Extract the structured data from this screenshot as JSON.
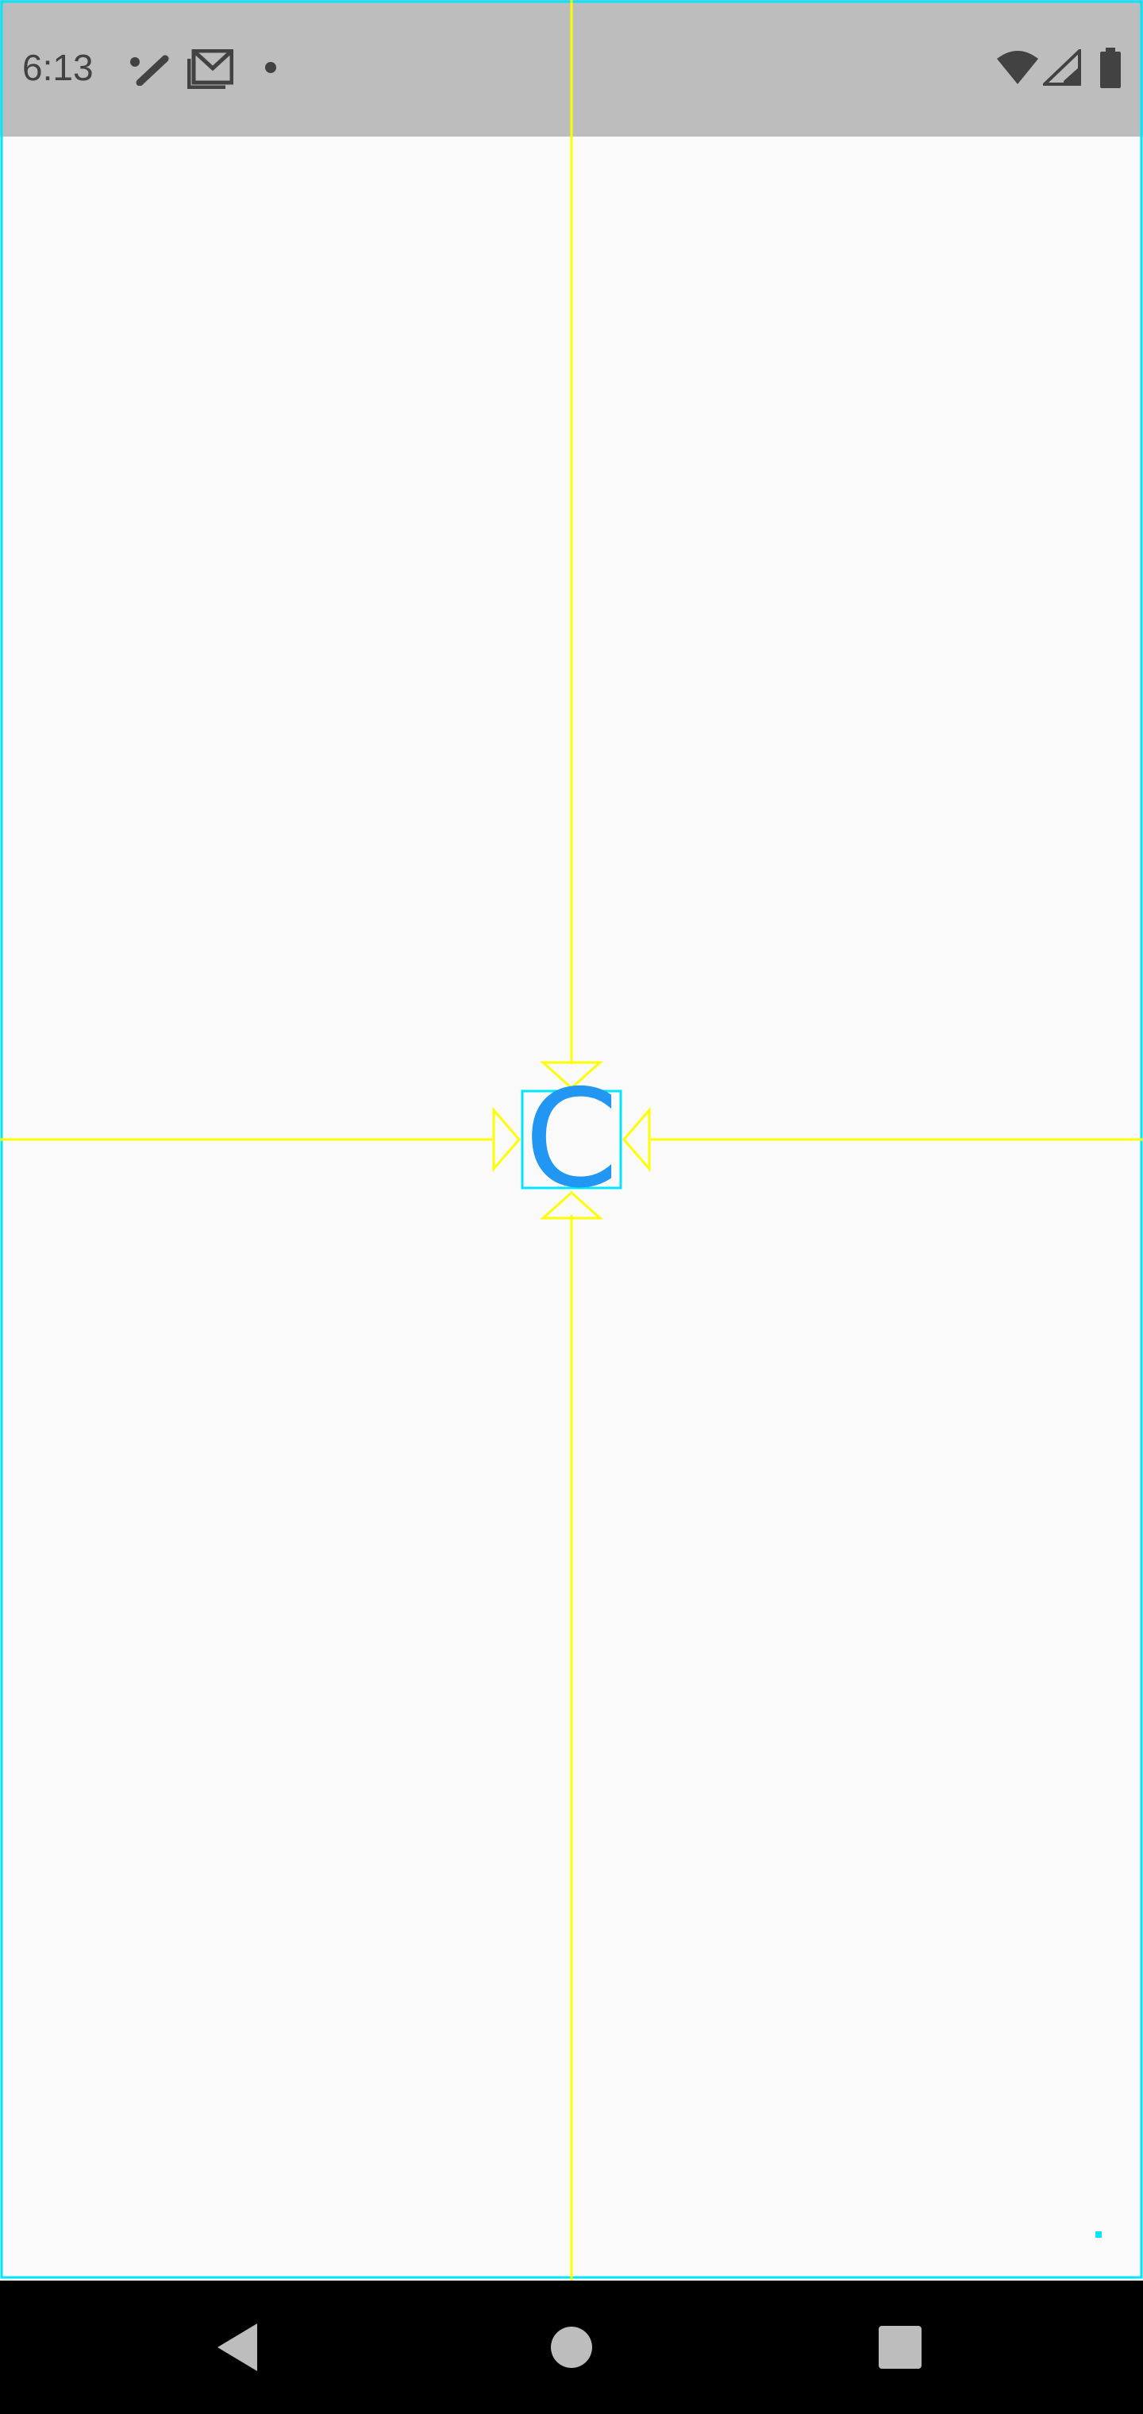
{
  "status_bar": {
    "time": "6:13",
    "left_icons": [
      "pen-tool-icon",
      "gmail-icon",
      "notification-dot-icon"
    ],
    "right_icons": [
      "wifi-icon",
      "cellular-signal-icon",
      "battery-icon"
    ]
  },
  "content": {
    "centered_glyph": "C",
    "glyph_color": "#2196f3",
    "guide_color": "#ffff00",
    "bounds_color": "#00e5ff",
    "background": "#fafafa"
  },
  "nav_bar": {
    "buttons": [
      "back-icon",
      "home-icon",
      "recents-icon"
    ],
    "background": "#000000"
  }
}
